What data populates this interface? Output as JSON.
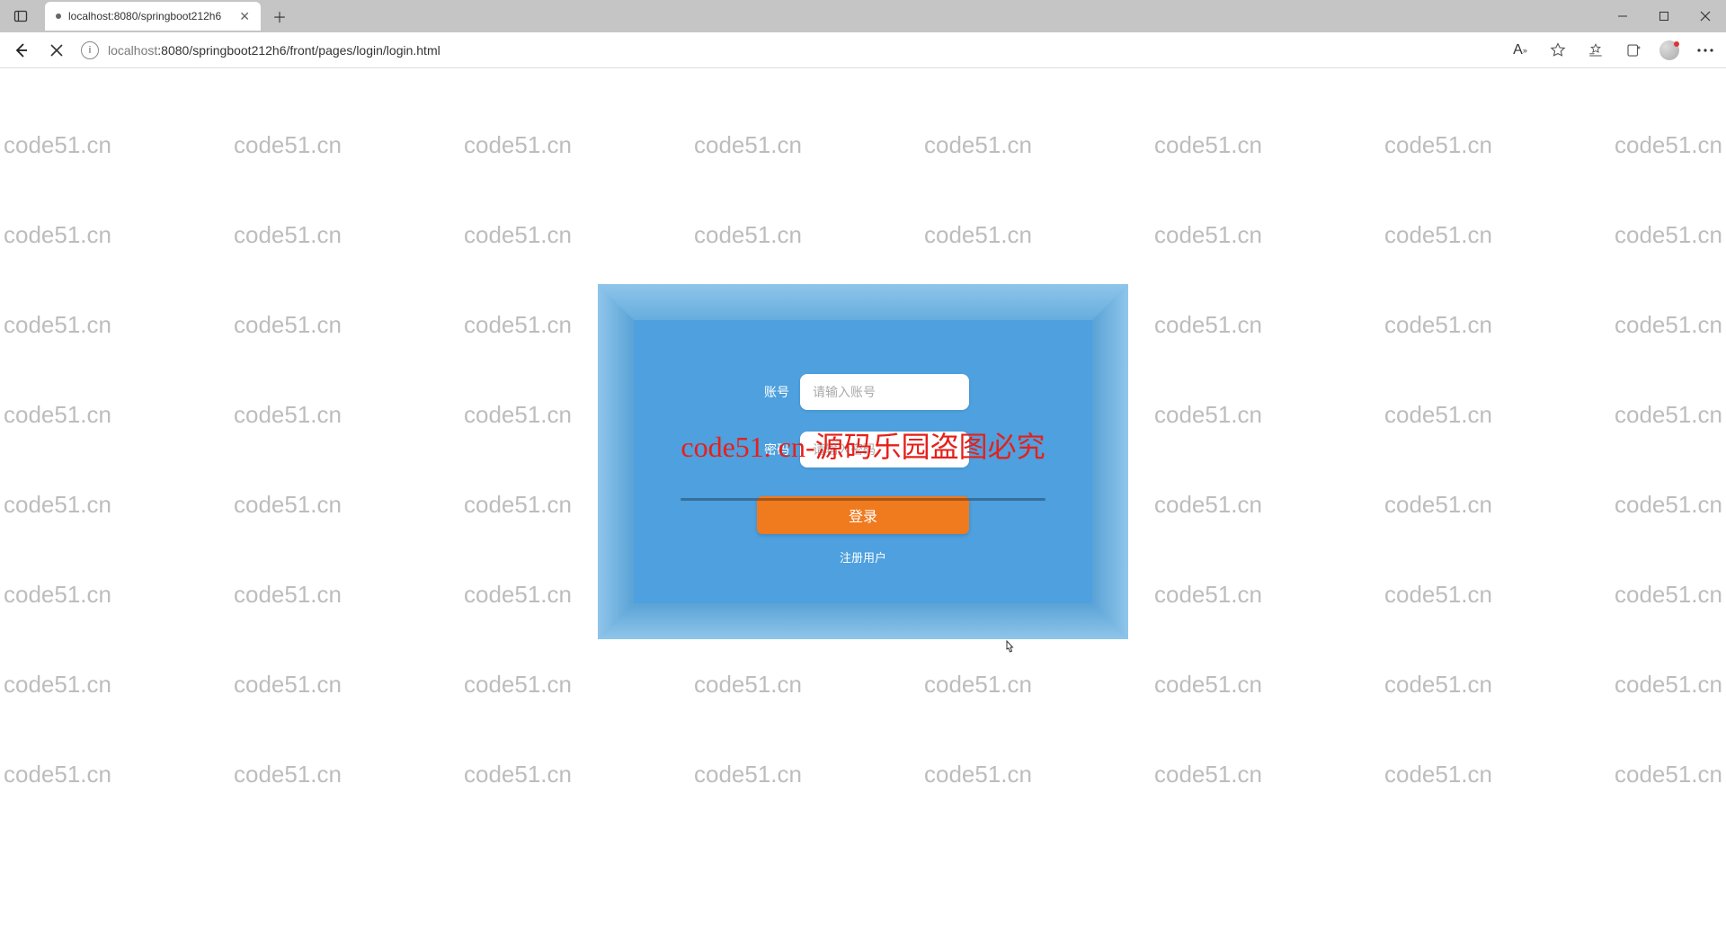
{
  "browser": {
    "tab_title": "localhost:8080/springboot212h6",
    "url_muted_prefix": "localhost",
    "url_rest": ":8080/springboot212h6/front/pages/login/login.html"
  },
  "watermark": {
    "text": "code51.cn",
    "overlay": "code51. cn-源码乐园盗图必究"
  },
  "login": {
    "username_label": "账号",
    "username_placeholder": "请输入账号",
    "password_label": "密码",
    "password_placeholder": "请输入密码",
    "login_button": "登录",
    "register_link": "注册用户"
  }
}
